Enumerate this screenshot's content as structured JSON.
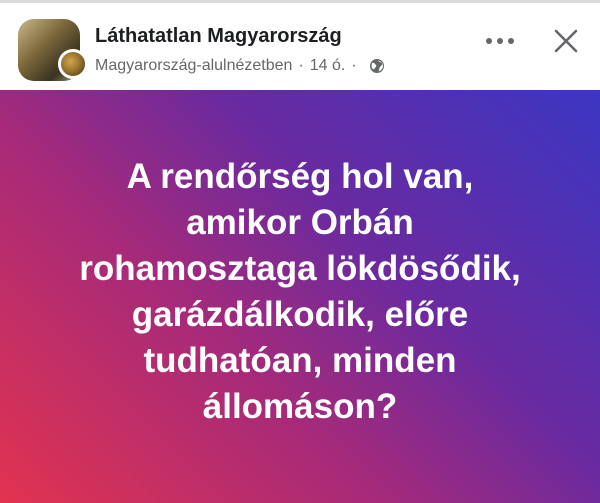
{
  "header": {
    "page_name": "Láthatatlan Magyarország",
    "group_name": "Magyarország-alulnézetben",
    "separator": "·",
    "time_ago": "14 ó.",
    "avatar_icon": "page-avatar",
    "privacy_icon": "globe-icon",
    "more_icon": "ellipsis-icon",
    "close_icon": "close-icon"
  },
  "post": {
    "text": "A rendőrség hol van,\namikor Orbán\nrohamosztaga lökdösődik,\ngarázdálkodik, előre\ntudhatóan, minden\nállomáson?"
  },
  "colors": {
    "gradient_start": "#e2334f",
    "gradient_mid": "#8a2a8f",
    "gradient_end": "#3b36c2",
    "text": "#ffffff",
    "meta_text": "#65676b"
  }
}
